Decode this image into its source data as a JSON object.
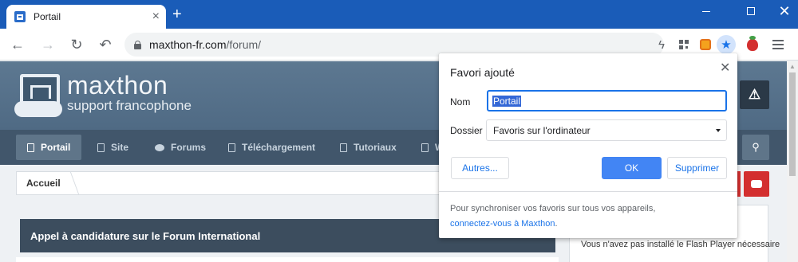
{
  "browser": {
    "tab": {
      "title": "Portail"
    },
    "address": {
      "host": "maxthon-fr.com",
      "path": "/forum/"
    }
  },
  "site": {
    "logo": {
      "name": "maxthon",
      "subtitle": "support francophone"
    },
    "nav": [
      {
        "label": "Portail",
        "active": true
      },
      {
        "label": "Site"
      },
      {
        "label": "Forums"
      },
      {
        "label": "Téléchargement"
      },
      {
        "label": "Tutoriaux"
      },
      {
        "label": "W"
      }
    ],
    "breadcrumb": "Accueil",
    "announcement": "Appel à candidature sur le Forum International",
    "sidebar_notice": "Vous n'avez pas installé le Flash Player nécessaire"
  },
  "dialog": {
    "title": "Favori ajouté",
    "name_label": "Nom",
    "name_value": "Portail",
    "folder_label": "Dossier",
    "folder_value": "Favoris sur l'ordinateur",
    "more_button": "Autres...",
    "ok_button": "OK",
    "delete_button": "Supprimer",
    "sync_text": "Pour synchroniser vos favoris sur tous vos appareils,",
    "sync_link": "connectez-vous à Maxthon",
    "sync_end": "."
  },
  "colors": {
    "titlebar": "#1a5cb8",
    "accent": "#1a73e8",
    "ok_button": "#4285f4",
    "site_nav": "#41566b",
    "announce": "#3c4d5e",
    "youtube": "#d32f2f"
  }
}
